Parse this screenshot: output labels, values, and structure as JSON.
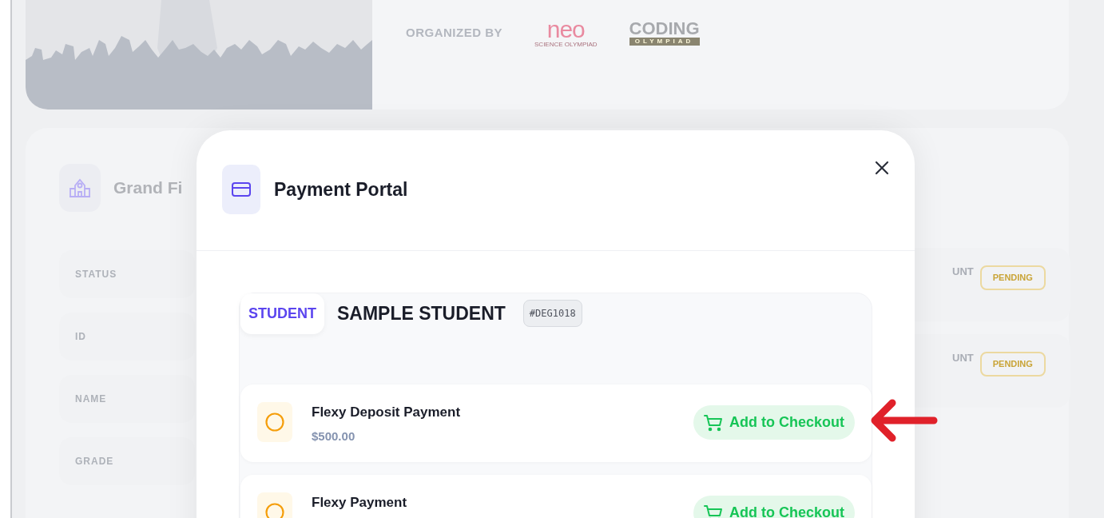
{
  "organizer": {
    "label": "ORGANIZED BY",
    "logos": [
      {
        "kind": "neo",
        "text": "neo",
        "subtext": "SCIENCE OLYMPIAD"
      },
      {
        "kind": "coding",
        "text": "CODING",
        "subtext": "OLYMPIAD"
      }
    ]
  },
  "event": {
    "title": "Grand Fi"
  },
  "fields": [
    "STATUS",
    "ID",
    "NAME",
    "GRADE"
  ],
  "right_rows": [
    {
      "label": "UNT",
      "badge": "PENDING"
    },
    {
      "label": "UNT",
      "badge": "PENDING"
    }
  ],
  "modal": {
    "title": "Payment Portal",
    "student": {
      "role": "STUDENT",
      "name": "SAMPLE STUDENT",
      "id": "#DEG1018"
    },
    "payments": [
      {
        "name": "Flexy Deposit Payment",
        "amount": "$500.00",
        "action": "Add to Checkout"
      },
      {
        "name": "Flexy Payment",
        "action": "Add to Checkout"
      }
    ]
  }
}
